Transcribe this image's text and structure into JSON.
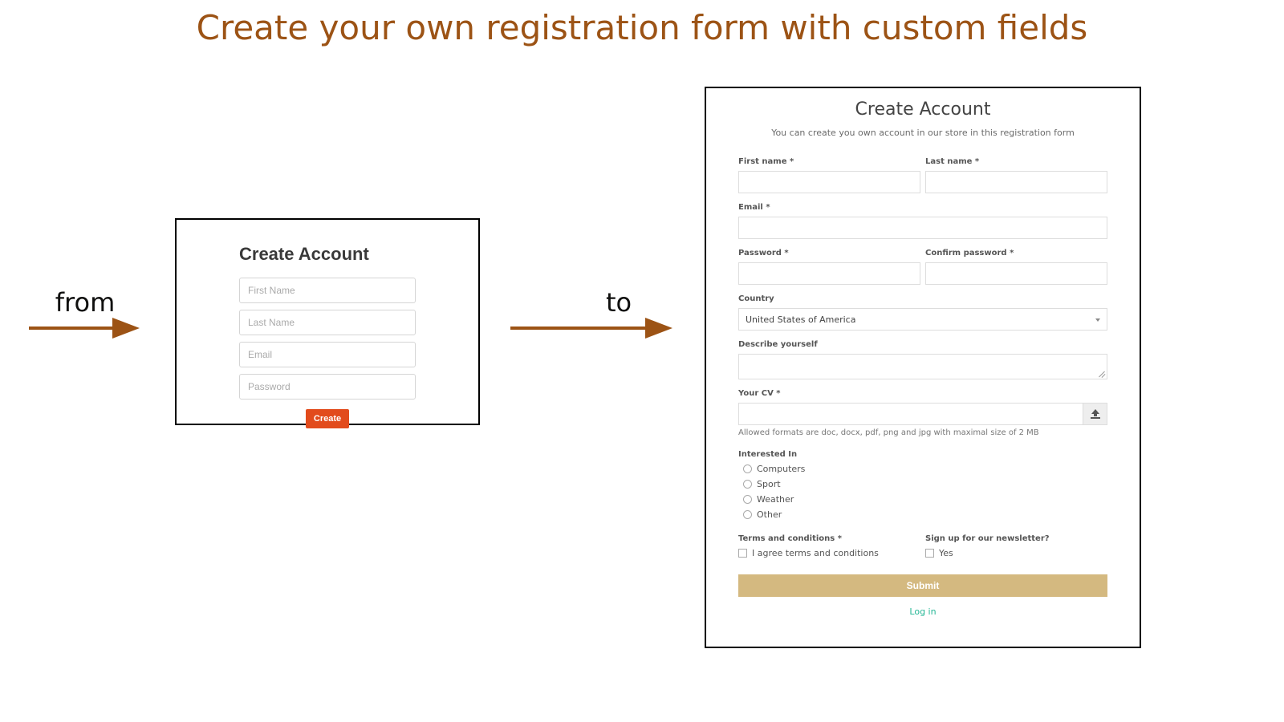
{
  "title": "Create your own registration form with custom fields",
  "arrows": {
    "from": "from",
    "to": "to"
  },
  "simple": {
    "heading": "Create Account",
    "first_name_ph": "First Name",
    "last_name_ph": "Last Name",
    "email_ph": "Email",
    "password_ph": "Password",
    "create_btn": "Create"
  },
  "ext": {
    "heading": "Create Account",
    "subtitle": "You can create you own account in our store in this registration form",
    "labels": {
      "first_name": "First name *",
      "last_name": "Last name *",
      "email": "Email *",
      "password": "Password *",
      "confirm_password": "Confirm password *",
      "country": "Country",
      "describe": "Describe yourself",
      "cv": "Your CV *",
      "interested": "Interested In",
      "terms": "Terms and conditions *",
      "newsletter": "Sign up for our newsletter?"
    },
    "country_value": "United States of America",
    "cv_hint": "Allowed formats are doc, docx, pdf, png and jpg with maximal size of 2 MB",
    "interests": {
      "computers": "Computers",
      "sport": "Sport",
      "weather": "Weather",
      "other": "Other"
    },
    "terms_checkbox": "I agree terms and conditions",
    "newsletter_checkbox": "Yes",
    "submit": "Submit",
    "login": "Log in"
  }
}
